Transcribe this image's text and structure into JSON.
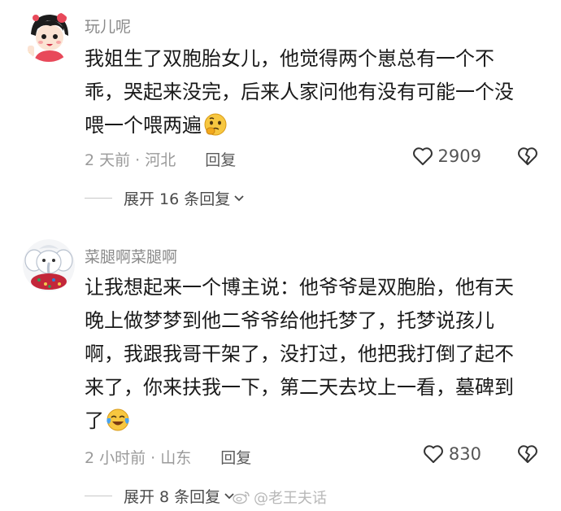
{
  "comments": [
    {
      "username": "玩儿呢",
      "lines": [
        "我姐生了双胞胎女儿，他觉得两个崽总有一个不",
        "乖，哭起来没完，后来人家问他有没有可能一个没",
        "喂一个喂两遍"
      ],
      "emoji": "thinking-face-emoji",
      "time_location": "2 天前 · 河北",
      "reply_label": "回复",
      "likes": "2909",
      "expand_label": "展开 16 条回复"
    },
    {
      "username": "菜腿啊菜腿啊",
      "lines": [
        "让我想起来一个博主说：他爷爷是双胞胎，他有天",
        "晚上做梦梦到他二爷爷给他托梦了，托梦说孩儿",
        "啊，我跟我哥干架了，没打过，他把我打倒了起不",
        "来了，你来扶我一下，第二天去坟上一看，墓碑到",
        "了"
      ],
      "emoji": "crying-laughing-emoji",
      "time_location": "2 小时前 · 山东",
      "reply_label": "回复",
      "likes": "830",
      "expand_label": "展开 8 条回复"
    }
  ],
  "watermark": {
    "text": "@老王夫话",
    "icon": "weibo-icon"
  },
  "colors": {
    "username": "#8a8a8a",
    "body_text": "#1a1a1a",
    "meta": "#9a9a9a",
    "expand": "#4a4a4a"
  }
}
